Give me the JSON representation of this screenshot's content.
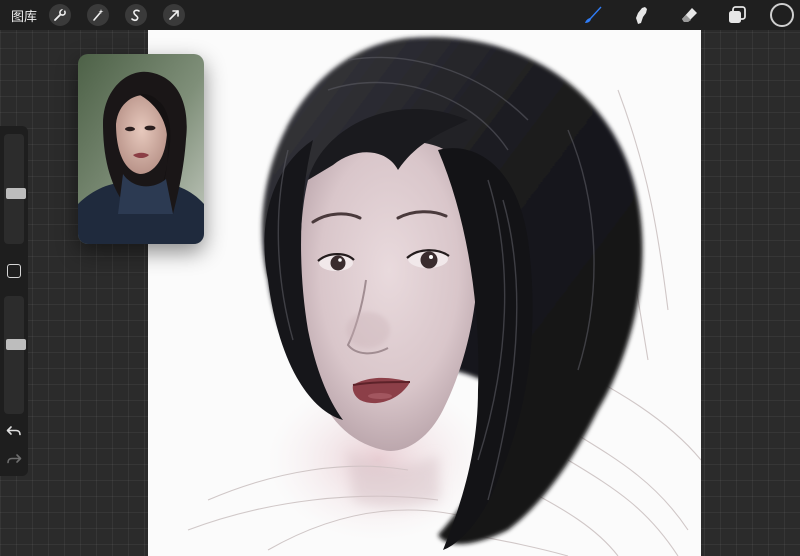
{
  "header": {
    "gallery_label": "图库",
    "left_tools": [
      "wrench-icon",
      "magic-wand-icon",
      "selection-s-icon",
      "transform-arrow-icon"
    ],
    "right_tools": [
      "brush-icon",
      "smudge-icon",
      "eraser-icon",
      "layers-icon"
    ],
    "active_tool": "brush-icon"
  },
  "colors": {
    "accent": "#2f7cf6",
    "toolbar": "#1f1f1f",
    "workspace": "#2b2b2b",
    "canvas": "#fbfbfb",
    "current_color": "#1f1f1f"
  },
  "sidebar": {
    "brush_size_level": 0.45,
    "opacity_level": 0.6,
    "undo_icon": "undo-icon",
    "redo_icon": "redo-icon"
  }
}
